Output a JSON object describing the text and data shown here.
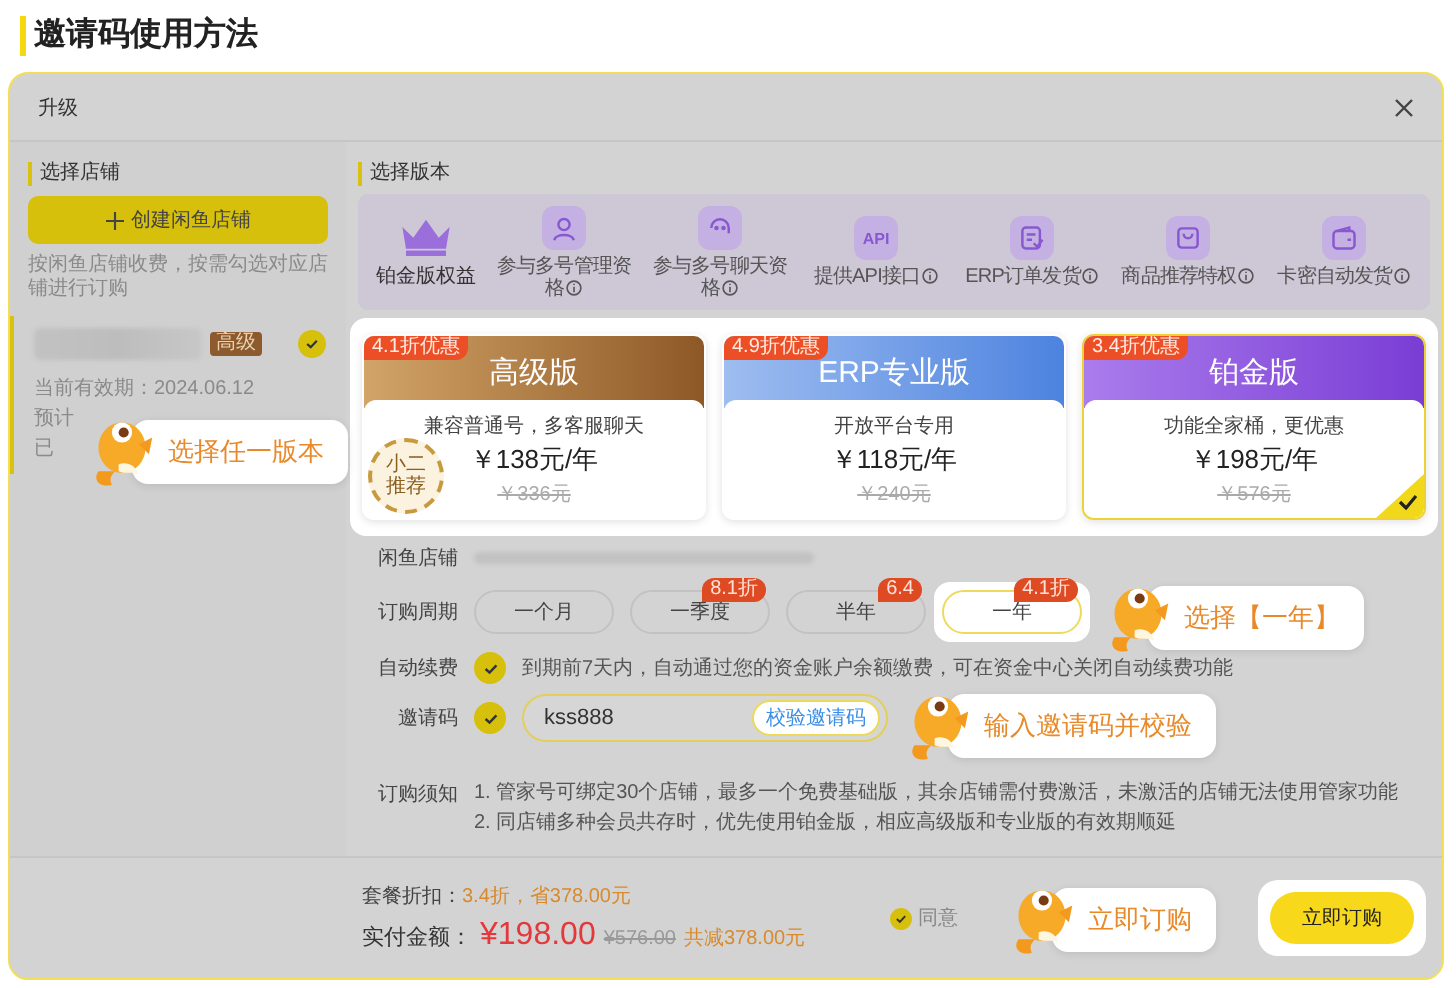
{
  "heading": "邀请码使用方法",
  "dialog": {
    "title": "升级"
  },
  "store_panel": {
    "title": "选择店铺",
    "create_button": "创建闲鱼店铺",
    "hint": "按闲鱼店铺收费，按需勾选对应店铺进行订购",
    "store": {
      "badge": "高级",
      "selected": true,
      "lines": [
        "当前有效期：2024.06.12",
        "预计",
        "已"
      ]
    }
  },
  "version_panel": {
    "title": "选择版本",
    "benefits_title": "铂金版权益",
    "benefits": [
      {
        "kind": "person",
        "label": "参与多号管理资格"
      },
      {
        "kind": "chat",
        "label": "参与多号聊天资格"
      },
      {
        "kind": "api",
        "icon_text": "API",
        "label": "提供API接口"
      },
      {
        "kind": "order",
        "label": "ERP订单发货"
      },
      {
        "kind": "bag",
        "label": "商品推荐特权"
      },
      {
        "kind": "card",
        "label": "卡密自动发货"
      }
    ]
  },
  "plans": [
    {
      "kind": "advanced",
      "discount": "4.1折优惠",
      "name": "高级版",
      "desc": "兼容普通号，多客服聊天",
      "price": "￥138元/年",
      "old_price": "￥336元",
      "recommend_seal": "小二推荐",
      "selected": false
    },
    {
      "kind": "erp",
      "discount": "4.9折优惠",
      "name": "ERP专业版",
      "desc": "开放平台专用",
      "price": "￥118元/年",
      "old_price": "￥240元",
      "selected": false
    },
    {
      "kind": "platinum",
      "discount": "3.4折优惠",
      "name": "铂金版",
      "desc": "功能全家桶，更优惠",
      "price": "￥198元/年",
      "old_price": "￥576元",
      "selected": true
    }
  ],
  "form": {
    "store_label": "闲鱼店铺",
    "period_label": "订购周期",
    "periods": [
      {
        "label": "一个月",
        "selected": false
      },
      {
        "label": "一季度",
        "tag": "8.1折",
        "selected": false
      },
      {
        "label": "半年",
        "tag": "6.4",
        "selected": false
      },
      {
        "label": "一年",
        "tag": "4.1折",
        "selected": true
      }
    ],
    "auto_renew": {
      "label": "自动续费",
      "checked": true,
      "text": "到期前7天内，自动通过您的资金账户余额缴费，可在资金中心关闭自动续费功能"
    },
    "invite": {
      "label": "邀请码",
      "checked": true,
      "value": "kss888",
      "verify_button": "校验邀请码"
    },
    "notice": {
      "label": "订购须知",
      "lines": [
        "1. 管家号可绑定30个店铺，最多一个免费基础版，其余店铺需付费激活，未激活的店铺无法使用管家功能",
        "2. 同店铺多种会员共存时，优先使用铂金版，相应高级版和专业版的有效期顺延"
      ]
    }
  },
  "footer": {
    "discount_label": "套餐折扣：",
    "discount": "3.4折，省378.00元",
    "pay_label": "实付金额：",
    "price": "¥198.00",
    "old_price": "¥576.00",
    "saved": "共减378.00元",
    "agree_checked": true,
    "agree": "同意",
    "order_button": "立即订购"
  },
  "guides": [
    {
      "text": "选择任一版本"
    },
    {
      "text": "选择【一年】"
    },
    {
      "text": "输入邀请码并校验"
    },
    {
      "text": "立即订购"
    }
  ]
}
